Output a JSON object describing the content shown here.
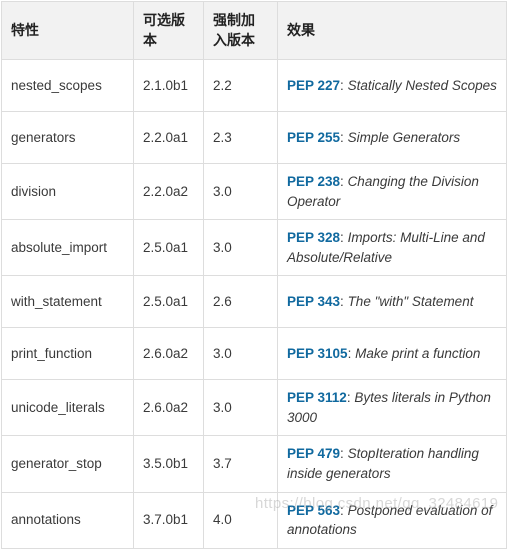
{
  "table": {
    "headers": [
      {
        "label": "特性"
      },
      {
        "label": "可选版本"
      },
      {
        "label": "强制加入版本"
      },
      {
        "label": "效果"
      }
    ],
    "rows": [
      {
        "feature": "nested_scopes",
        "optional_version": "2.1.0b1",
        "mandatory_version": "2.2",
        "effect": {
          "pep": "PEP 227",
          "separator": ": ",
          "description": "Statically Nested Scopes"
        }
      },
      {
        "feature": "generators",
        "optional_version": "2.2.0a1",
        "mandatory_version": "2.3",
        "effect": {
          "pep": "PEP 255",
          "separator": ": ",
          "description": "Simple Generators"
        }
      },
      {
        "feature": "division",
        "optional_version": "2.2.0a2",
        "mandatory_version": "3.0",
        "effect": {
          "pep": "PEP 238",
          "separator": ": ",
          "description": "Changing the Division Operator"
        }
      },
      {
        "feature": "absolute_import",
        "optional_version": "2.5.0a1",
        "mandatory_version": "3.0",
        "effect": {
          "pep": "PEP 328",
          "separator": ": ",
          "description": "Imports: Multi-Line and Absolute/Relative"
        }
      },
      {
        "feature": "with_statement",
        "optional_version": "2.5.0a1",
        "mandatory_version": "2.6",
        "effect": {
          "pep": "PEP 343",
          "separator": ": ",
          "description": "The \"with\" Statement"
        }
      },
      {
        "feature": "print_function",
        "optional_version": "2.6.0a2",
        "mandatory_version": "3.0",
        "effect": {
          "pep": "PEP 3105",
          "separator": ": ",
          "description": "Make print a function"
        }
      },
      {
        "feature": "unicode_literals",
        "optional_version": "2.6.0a2",
        "mandatory_version": "3.0",
        "effect": {
          "pep": "PEP 3112",
          "separator": ": ",
          "description": "Bytes literals in Python 3000"
        }
      },
      {
        "feature": "generator_stop",
        "optional_version": "3.5.0b1",
        "mandatory_version": "3.7",
        "effect": {
          "pep": "PEP 479",
          "separator": ": ",
          "description": "StopIteration handling inside generators"
        }
      },
      {
        "feature": "annotations",
        "optional_version": "3.7.0b1",
        "mandatory_version": "4.0",
        "effect": {
          "pep": "PEP 563",
          "separator": ": ",
          "description": "Postponed evaluation of annotations"
        }
      }
    ]
  },
  "watermark": {
    "text": "https://blog.csdn.net/qq_32484619"
  },
  "colors": {
    "link": "#10699f",
    "header_background": "#f2f2f2",
    "border": "#dddddd",
    "text": "#3a3a3a"
  }
}
